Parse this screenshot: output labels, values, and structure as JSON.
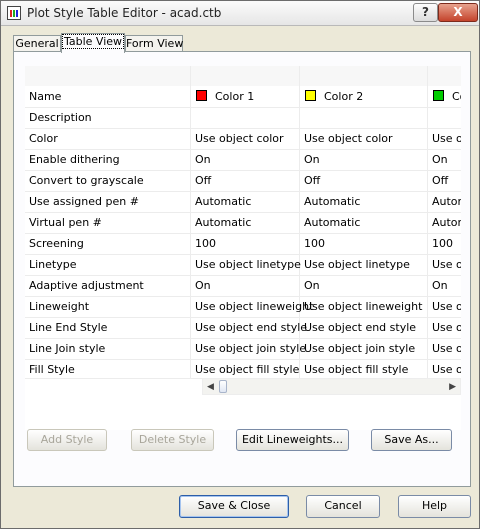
{
  "window": {
    "title": "Plot Style Table Editor - acad.ctb",
    "help_label": "?",
    "close_label": "X"
  },
  "tabs": [
    {
      "label": "General"
    },
    {
      "label": "Table View"
    },
    {
      "label": "Form View"
    }
  ],
  "table": {
    "columns": [
      {
        "label": "Color 1",
        "swatch": "#ff0000"
      },
      {
        "label": "Color 2",
        "swatch": "#ffff00"
      },
      {
        "label": "Co",
        "swatch": "#00cc00"
      }
    ],
    "rows": [
      {
        "label": "Name",
        "values": [
          "",
          "",
          ""
        ]
      },
      {
        "label": "Description",
        "values": [
          "",
          "",
          ""
        ]
      },
      {
        "label": "Color",
        "values": [
          "Use object color",
          "Use object color",
          "Use ol"
        ]
      },
      {
        "label": "Enable dithering",
        "values": [
          "On",
          "On",
          "On"
        ]
      },
      {
        "label": "Convert to grayscale",
        "values": [
          "Off",
          "Off",
          "Off"
        ]
      },
      {
        "label": "Use assigned pen #",
        "values": [
          "Automatic",
          "Automatic",
          "Autom"
        ]
      },
      {
        "label": "Virtual pen #",
        "values": [
          "Automatic",
          "Automatic",
          "Autom"
        ]
      },
      {
        "label": "Screening",
        "values": [
          "100",
          "100",
          "100"
        ]
      },
      {
        "label": "Linetype",
        "values": [
          "Use object linetype",
          "Use object linetype",
          "Use ol"
        ]
      },
      {
        "label": "Adaptive adjustment",
        "values": [
          "On",
          "On",
          "On"
        ]
      },
      {
        "label": "Lineweight",
        "values": [
          "Use object lineweight",
          "Use object lineweight",
          "Use ol"
        ]
      },
      {
        "label": "Line End Style",
        "values": [
          "Use object end style",
          "Use object end style",
          "Use ol"
        ]
      },
      {
        "label": "Line Join style",
        "values": [
          "Use object join style",
          "Use object join style",
          "Use ol"
        ]
      },
      {
        "label": "Fill Style",
        "values": [
          "Use object fill style",
          "Use object fill style",
          "Use ol"
        ]
      }
    ]
  },
  "panel_buttons": {
    "add_style": "Add Style",
    "delete_style": "Delete Style",
    "edit_lineweights": "Edit Lineweights...",
    "save_as": "Save As..."
  },
  "footer_buttons": {
    "save_close": "Save & Close",
    "cancel": "Cancel",
    "help": "Help"
  }
}
